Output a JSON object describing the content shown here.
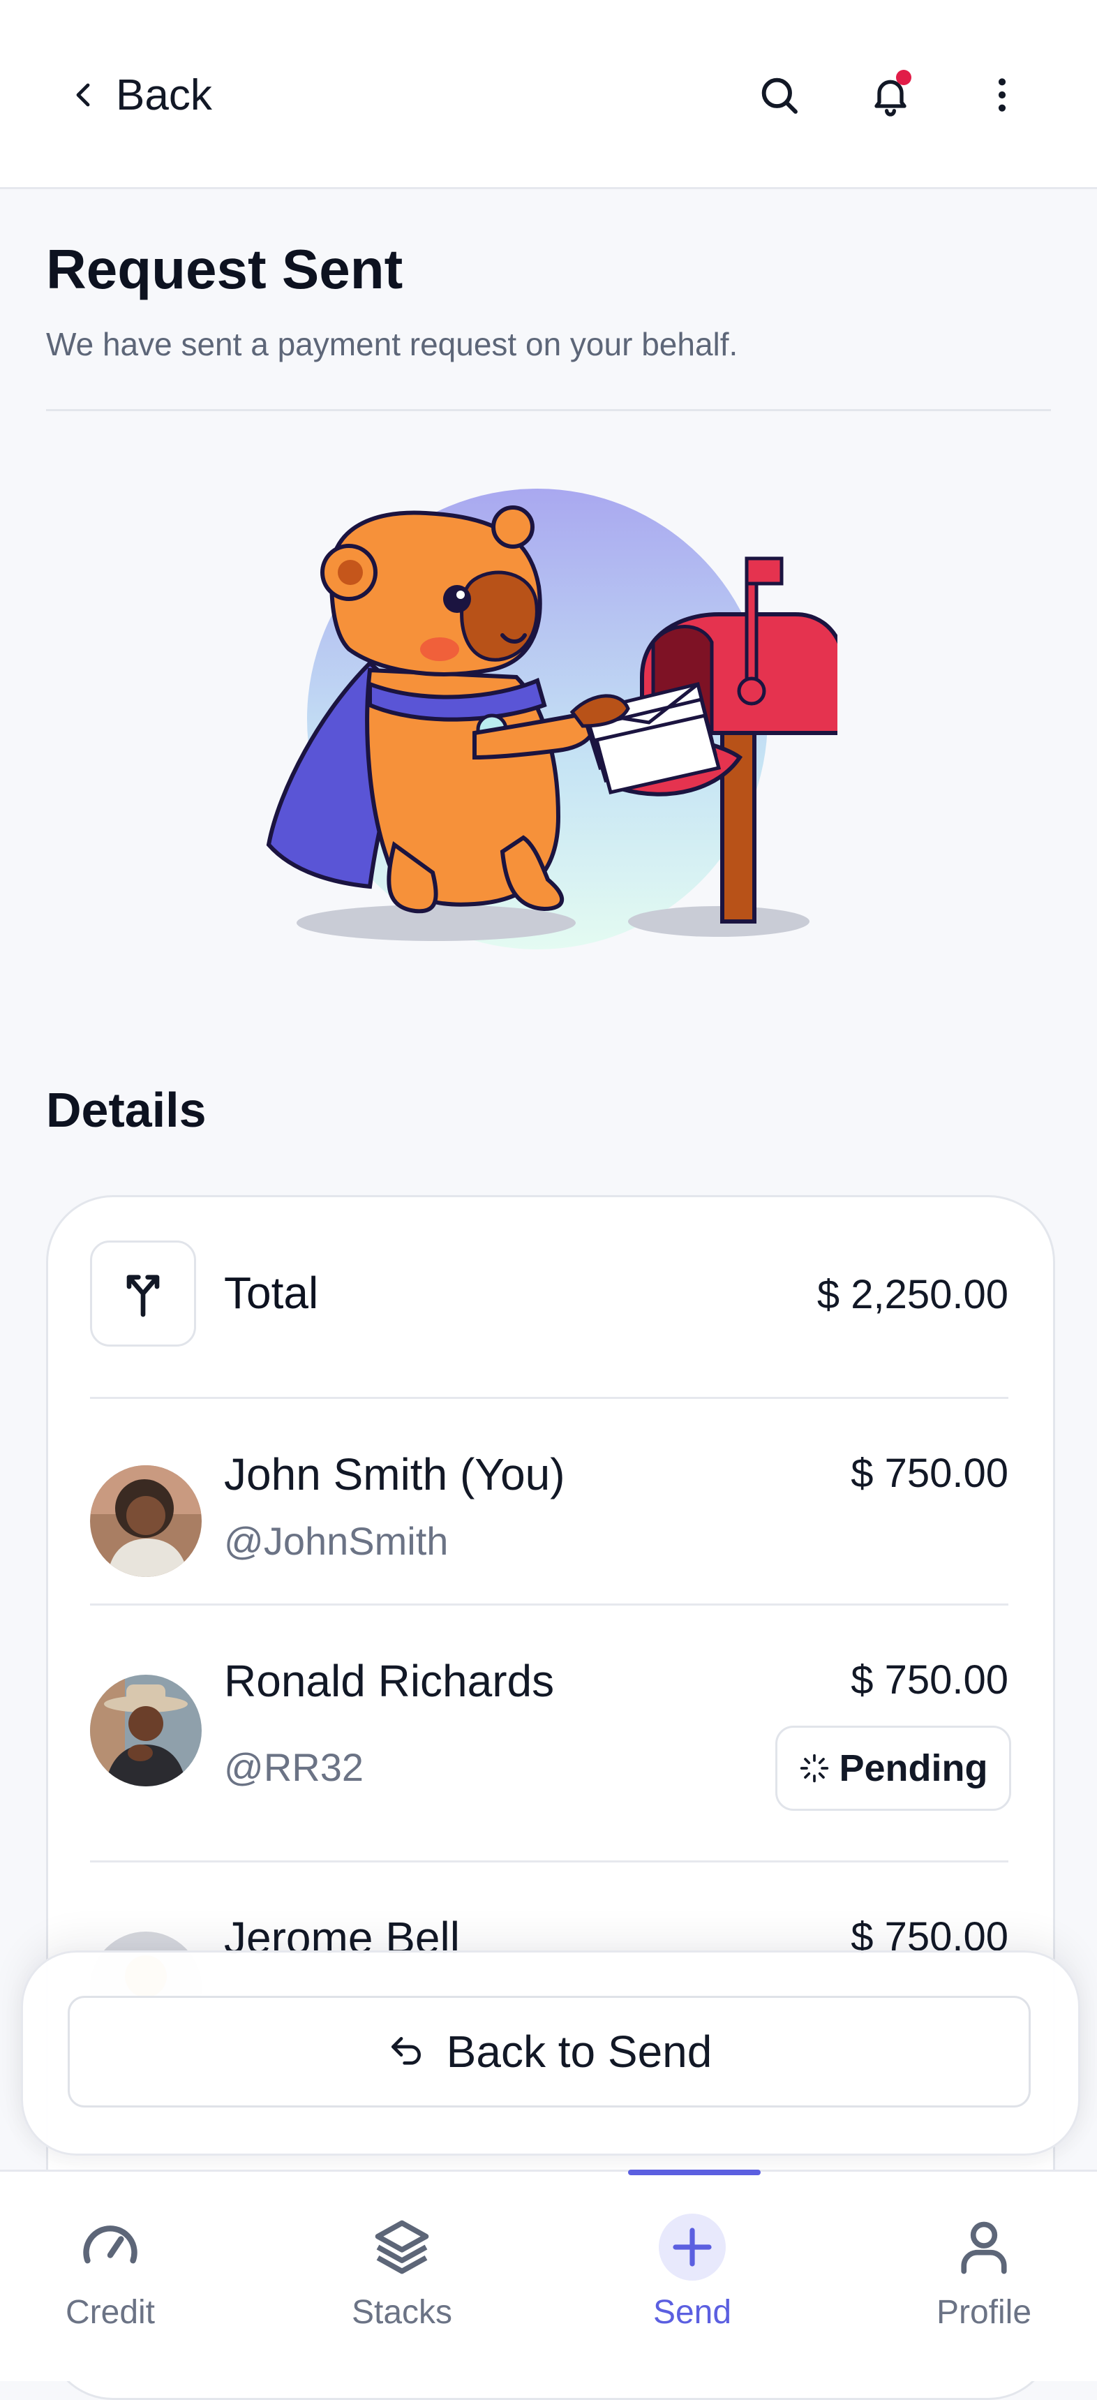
{
  "header": {
    "back_label": "Back"
  },
  "page": {
    "title": "Request Sent",
    "subtitle": "We have sent a payment request on your behalf."
  },
  "details": {
    "title": "Details",
    "total_label": "Total",
    "total_amount": "$ 2,250.00",
    "people": [
      {
        "name": "John Smith (You)",
        "handle": "@JohnSmith",
        "amount": "$ 750.00"
      },
      {
        "name": "Ronald Richards",
        "handle": "@RR32",
        "amount": "$ 750.00",
        "status": "Pending"
      },
      {
        "name": "Jerome Bell",
        "amount": "$ 750.00"
      }
    ]
  },
  "actions": {
    "back_to_send": "Back to Send"
  },
  "nav": {
    "items": [
      {
        "label": "Credit",
        "icon": "gauge-icon"
      },
      {
        "label": "Stacks",
        "icon": "stack-icon"
      },
      {
        "label": "Send",
        "icon": "plus-icon"
      },
      {
        "label": "Profile",
        "icon": "user-icon"
      }
    ],
    "active": "Send"
  },
  "colors": {
    "accent": "#5b5fe0",
    "notification": "#e11d48",
    "mailbox": "#e5334f",
    "capybara": "#f6913a"
  }
}
